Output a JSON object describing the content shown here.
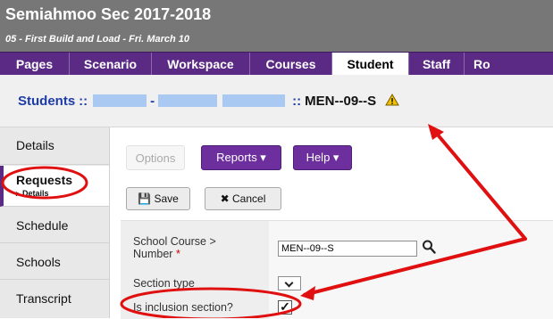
{
  "app": {
    "title": "Semiahmoo Sec 2017-2018",
    "context": "05 - First Build and Load - Fri. March 10"
  },
  "tabs": [
    "Pages",
    "Scenario",
    "Workspace",
    "Courses",
    "Student",
    "Staff",
    "Ro"
  ],
  "active_tab": "Student",
  "breadcrumb": {
    "link": "Students",
    "separator": "::",
    "dash": "-",
    "record": "MEN--09--S"
  },
  "sidebar": {
    "items": [
      {
        "label": "Details"
      },
      {
        "label": "Requests",
        "sub": "▸ Details"
      },
      {
        "label": "Schedule"
      },
      {
        "label": "Schools"
      },
      {
        "label": "Transcript"
      }
    ],
    "active_index": 1
  },
  "toolbar": {
    "options": "Options",
    "reports": "Reports ▾",
    "help": "Help ▾",
    "save": "💾 Save",
    "cancel": "✖ Cancel"
  },
  "form": {
    "course_label": "School Course > Number",
    "required_mark": "*",
    "course_value": "MEN--09--S",
    "section_type_label": "Section type",
    "inclusion_label": "Is inclusion section?",
    "inclusion_checked": true
  },
  "icons": {
    "warning": "warning-icon",
    "search": "search-icon",
    "save": "save-icon",
    "cancel": "close-icon",
    "dropdown": "chevron-down-icon"
  },
  "colors": {
    "title_bar": "#777777",
    "tab_bar": "#5b2a84",
    "button_purple": "#6d2e9e",
    "annotation": "#e01010",
    "link": "#1e3ca8"
  }
}
